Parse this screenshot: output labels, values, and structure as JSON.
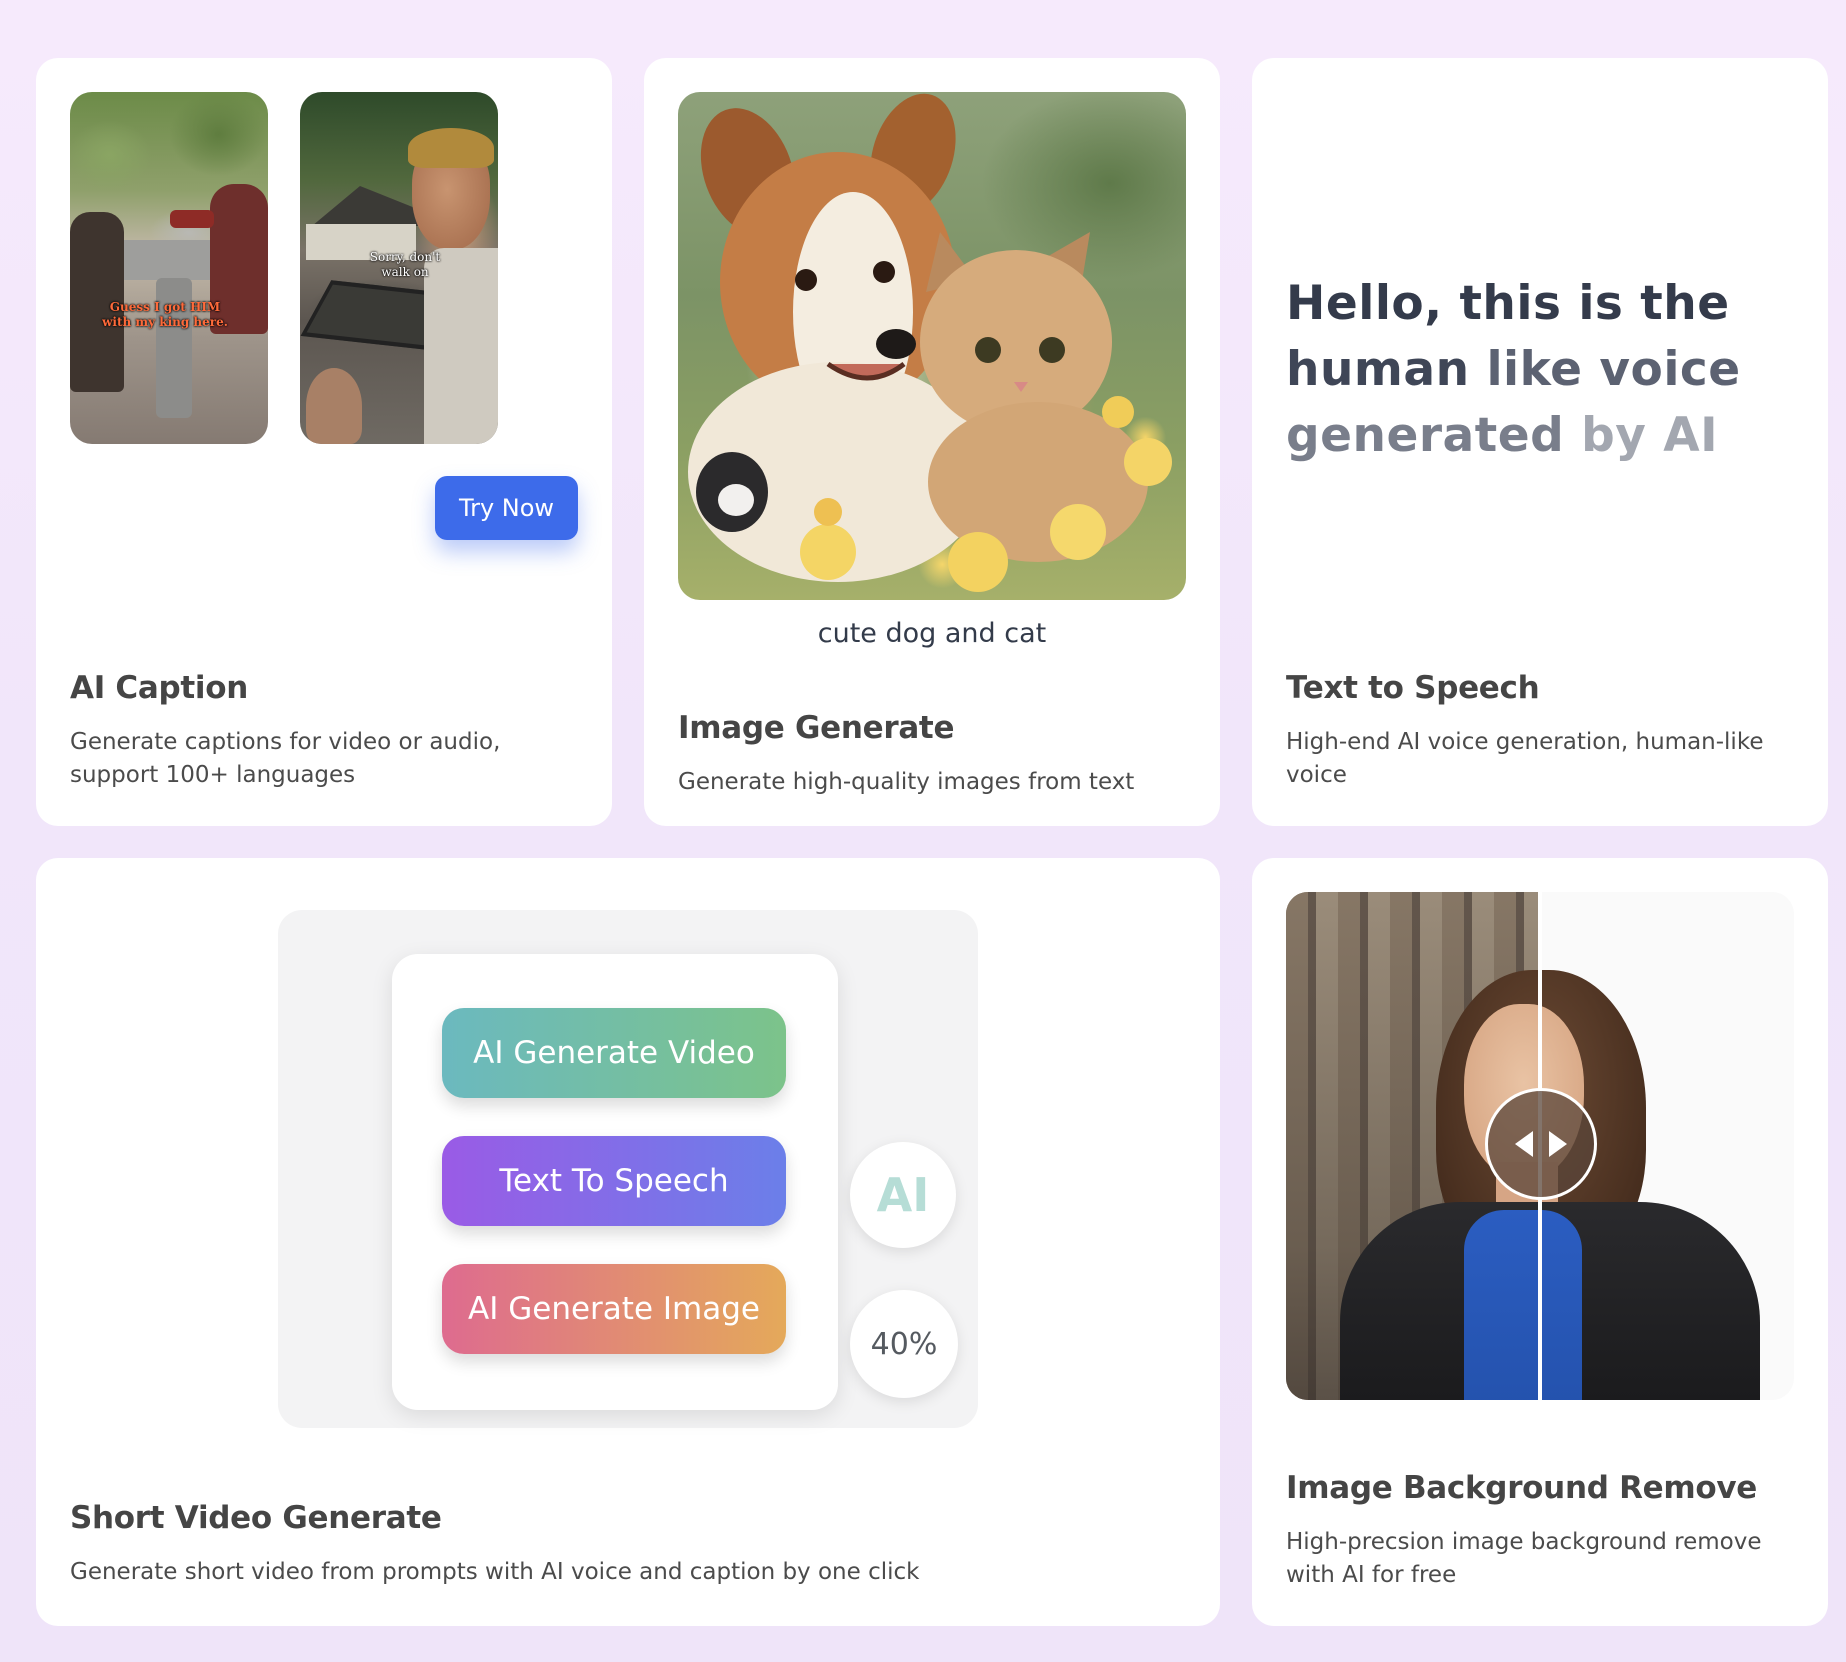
{
  "ai_caption": {
    "title": "AI Caption",
    "desc_line1": "Generate captions for video or audio,",
    "desc_line2": "support 100+ languages",
    "clip1_caption_line1": "Guess I got HIM",
    "clip1_caption_line2": "with my king here.",
    "clip2_caption_line1": "Sorry, don't",
    "clip2_caption_line2": "walk on",
    "try_button": "Try Now"
  },
  "image_generate": {
    "prompt": "cute dog and cat",
    "title": "Image Generate",
    "desc": "Generate high-quality images from text"
  },
  "text_to_speech": {
    "line1": "Hello, this is the",
    "line2a": "human",
    "line2b": " like voice",
    "line3a": "generated",
    "line3b": " by AI",
    "title": "Text to Speech",
    "desc_line1": "High-end AI voice generation, human-like",
    "desc_line2": "voice"
  },
  "short_video": {
    "btn_video": "AI Generate Video",
    "btn_tts": "Text To Speech",
    "btn_image": "AI Generate Image",
    "ai_badge": "AI",
    "progress_label": "40%",
    "progress_value": 0.4,
    "title": "Short Video Generate",
    "desc": "Generate short video from prompts with AI voice and caption by one click"
  },
  "bg_remove": {
    "title": "Image Background Remove",
    "desc_line1": "High-precsion image background remove",
    "desc_line2": "with AI for free"
  },
  "colors": {
    "page_bg": "#f3e8fb",
    "card_bg": "#ffffff",
    "accent_blue": "#3d6bea",
    "title_text": "#454545",
    "tts_dark": "#343b4b",
    "tts_mid": "#5c6272",
    "tts_light": "#9b9fa9"
  }
}
